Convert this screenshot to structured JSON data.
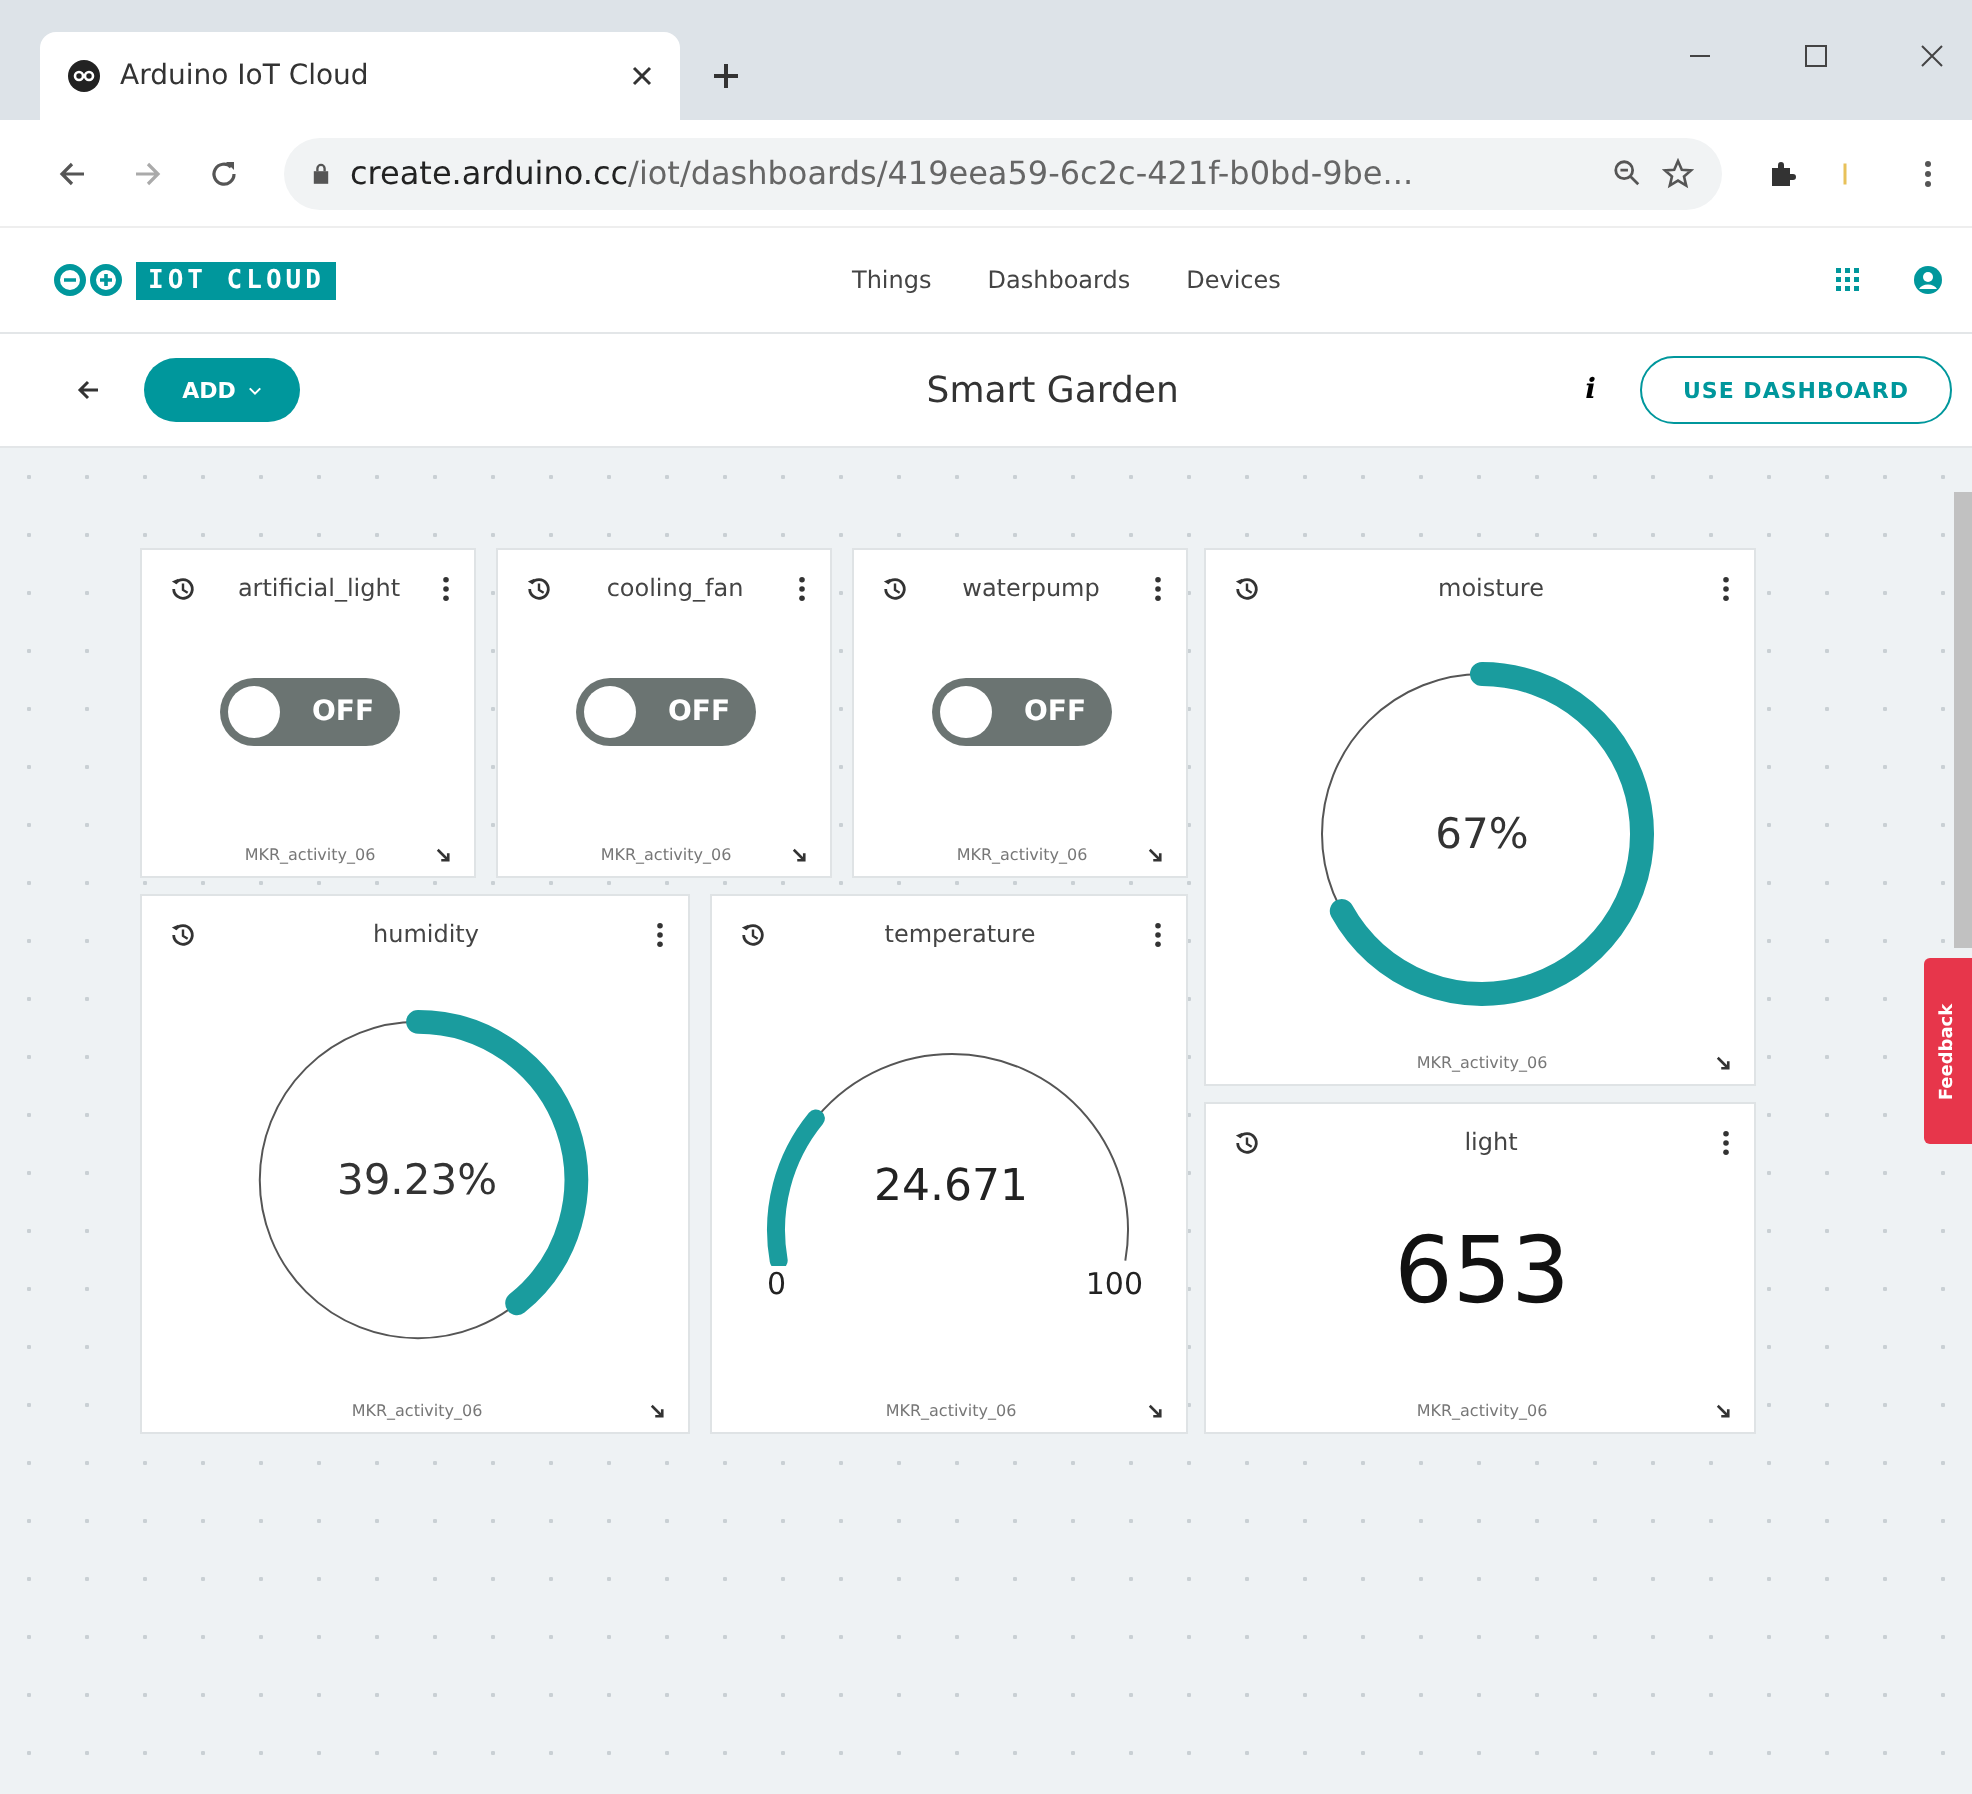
{
  "browser": {
    "tab_title": "Arduino IoT Cloud",
    "url_host": "create.arduino.cc",
    "url_path": "/iot/dashboards/419eea59-6c2c-421f-b0bd-9be..."
  },
  "app": {
    "logo_text": "IOT CLOUD",
    "nav": [
      {
        "label": "Things"
      },
      {
        "label": "Dashboards"
      },
      {
        "label": "Devices"
      }
    ]
  },
  "toolbar": {
    "add_button": "ADD",
    "title": "Smart Garden",
    "info": "i",
    "use_button": "USE DASHBOARD"
  },
  "widgets": [
    {
      "kind": "switch",
      "title": "artificial_light",
      "on": false,
      "state_label": "OFF",
      "device": "MKR_activity_06"
    },
    {
      "kind": "switch",
      "title": "cooling_fan",
      "on": false,
      "state_label": "OFF",
      "device": "MKR_activity_06"
    },
    {
      "kind": "switch",
      "title": "waterpump",
      "on": false,
      "state_label": "OFF",
      "device": "MKR_activity_06"
    },
    {
      "kind": "percentage",
      "title": "moisture",
      "value": "67%",
      "device": "MKR_activity_06"
    },
    {
      "kind": "percentage",
      "title": "humidity",
      "value": "39.23%",
      "device": "MKR_activity_06"
    },
    {
      "kind": "gauge",
      "title": "temperature",
      "value": "24.671",
      "min": "0",
      "max": "100",
      "device": "MKR_activity_06"
    },
    {
      "kind": "value",
      "title": "light",
      "value": "653",
      "device": "MKR_activity_06"
    }
  ],
  "feedback": "Feedback"
}
